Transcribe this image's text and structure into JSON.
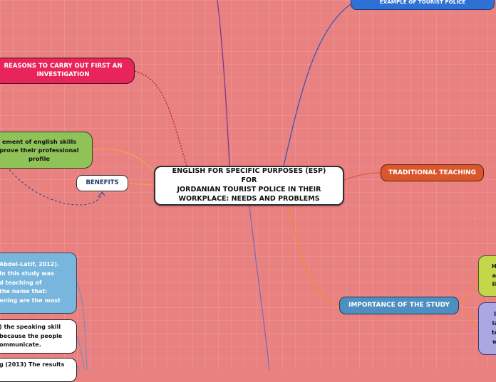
{
  "central_topic": {
    "line1": "ENGLISH FOR SPECIFIC PURPOSES (ESP) FOR",
    "line2": "JORDANIAN TOURIST POLICE IN THEIR",
    "line3": "WORKPLACE: NEEDS AND PROBLEMS"
  },
  "topics": {
    "reasons": {
      "line1": "REASONS TO CARRY OUT FIRST AN",
      "line2": "INVESTIGATION"
    },
    "improvement": {
      "line1": "ement of english skills",
      "line2": "prove their professional",
      "line3": "profile"
    },
    "benefits": "BENEFITS",
    "traditional_teaching": "TRADITIONAL TEACHING",
    "example": "EXAMPLE OF TOURIST POLICE",
    "importance": "IMPORTANCE OF THE STUDY"
  },
  "right_notes": {
    "green": {
      "line1": "H",
      "line2": "a",
      "line3": "li"
    },
    "lavender": {
      "line1": "I",
      "line2": "la",
      "line3": "to",
      "line4": "w"
    }
  },
  "left_notes": {
    "blue": {
      "line1": "Abdel-Latif, 2012).",
      "line2": "In this study was",
      "line3": "d teaching of",
      "line4": "the name that:",
      "line5": "ening are the most"
    },
    "white1": {
      "line1": ") the speaking skill",
      "line2": "because the people",
      "line3": "ommunicate."
    },
    "white2": {
      "line1": "g (2013) The results"
    }
  },
  "colors": {
    "background": "#e98181",
    "reasons": "#e8245a",
    "improvement": "#8fc257",
    "traditional": "#d9572a",
    "example": "#2f70d4",
    "importance": "#4d8fc0"
  }
}
